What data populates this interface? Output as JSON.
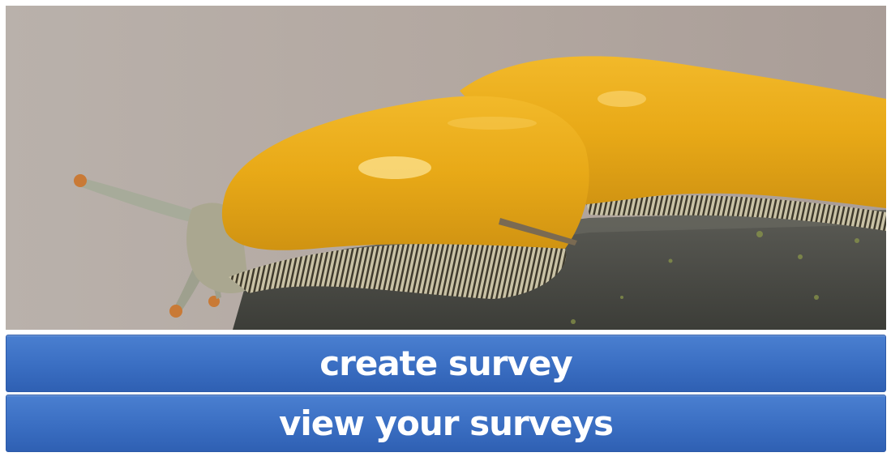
{
  "hero": {
    "image_subject": "banana slug"
  },
  "buttons": {
    "create_label": "create survey",
    "view_label": "view your surveys"
  },
  "colors": {
    "button_blue": "#3a6ec2",
    "button_text": "#ffffff"
  }
}
